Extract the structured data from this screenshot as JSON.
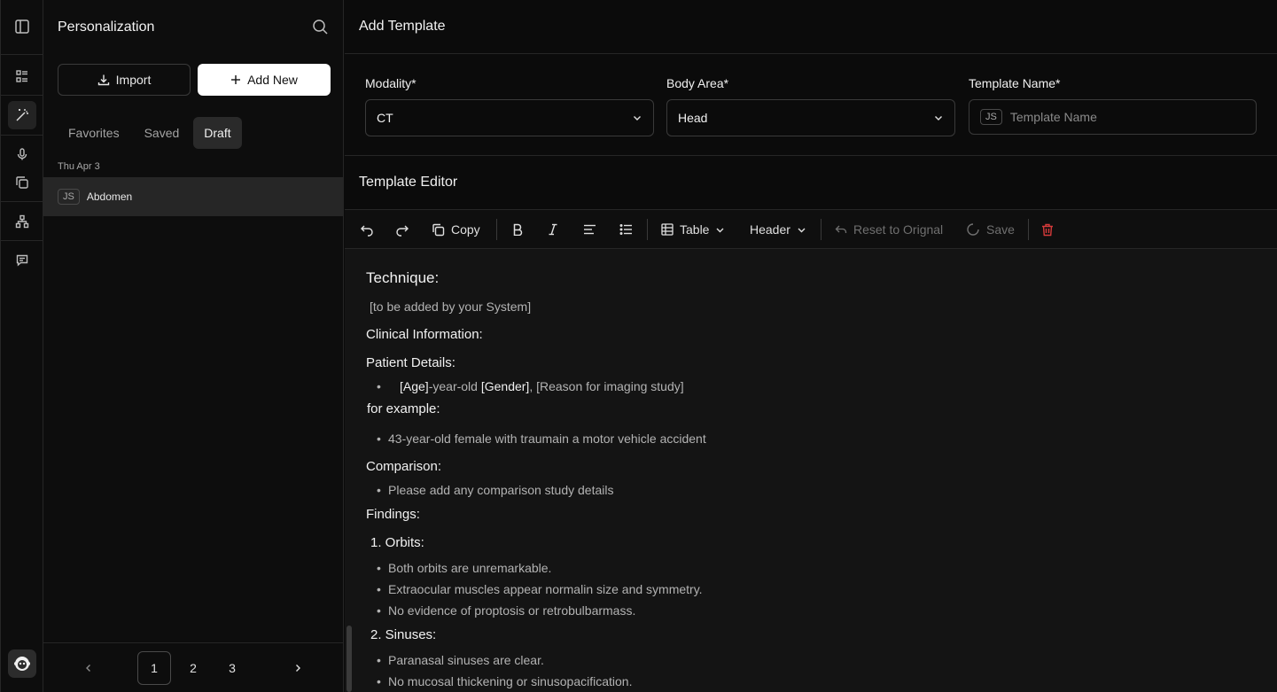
{
  "sidebar": {
    "title": "Personalization",
    "import_label": "Import",
    "add_new_label": "Add New",
    "tabs": [
      {
        "label": "Favorites"
      },
      {
        "label": "Saved"
      },
      {
        "label": "Draft"
      }
    ],
    "date_group": "Thu Apr 3",
    "items": [
      {
        "initials": "JS",
        "label": "Abdomen"
      }
    ],
    "pages": [
      "1",
      "2",
      "3"
    ]
  },
  "main": {
    "title": "Add Template",
    "modality": {
      "label": "Modality*",
      "value": "CT"
    },
    "body_area": {
      "label": "Body Area*",
      "value": "Head"
    },
    "template_name": {
      "label": "Template Name*",
      "initials": "JS",
      "placeholder": "Template Name"
    },
    "editor_title": "Template Editor",
    "toolbar": {
      "copy_label": "Copy",
      "table_label": "Table",
      "header_label": "Header",
      "reset_label": "Reset to Orignal",
      "save_label": "Save"
    },
    "content": {
      "technique_heading": "Technique:",
      "technique_text": "[to be added by your System]",
      "clinical_heading": "Clinical Information:",
      "patient_heading": "Patient Details:",
      "patient_age": "[Age]",
      "patient_mid": "-year-old ",
      "patient_gender": "[Gender]",
      "patient_reason": ", [Reason for imaging study]",
      "example_heading": "for example:",
      "example_item": "43-year-old female with traumain a motor vehicle accident",
      "comparison_heading": "Comparison:",
      "comparison_item": "Please add any comparison study details",
      "findings_heading": "Findings:",
      "orbits_heading": "1. Orbits:",
      "orbits_items": [
        "Both orbits are unremarkable.",
        "Extraocular muscles appear normalin size and symmetry.",
        "No evidence of proptosis or retrobulbarmass."
      ],
      "sinuses_heading": "2. Sinuses:",
      "sinuses_items": [
        "Paranasal sinuses are clear.",
        "No mucosal thickening or sinusopacification."
      ]
    }
  }
}
